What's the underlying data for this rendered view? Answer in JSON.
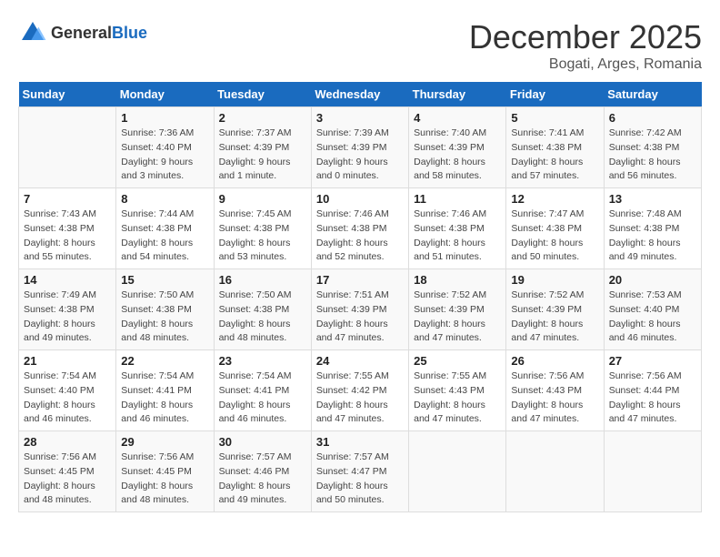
{
  "header": {
    "logo_general": "General",
    "logo_blue": "Blue",
    "title": "December 2025",
    "subtitle": "Bogati, Arges, Romania"
  },
  "calendar": {
    "days_of_week": [
      "Sunday",
      "Monday",
      "Tuesday",
      "Wednesday",
      "Thursday",
      "Friday",
      "Saturday"
    ],
    "weeks": [
      [
        {
          "day": "",
          "info": ""
        },
        {
          "day": "1",
          "info": "Sunrise: 7:36 AM\nSunset: 4:40 PM\nDaylight: 9 hours\nand 3 minutes."
        },
        {
          "day": "2",
          "info": "Sunrise: 7:37 AM\nSunset: 4:39 PM\nDaylight: 9 hours\nand 1 minute."
        },
        {
          "day": "3",
          "info": "Sunrise: 7:39 AM\nSunset: 4:39 PM\nDaylight: 9 hours\nand 0 minutes."
        },
        {
          "day": "4",
          "info": "Sunrise: 7:40 AM\nSunset: 4:39 PM\nDaylight: 8 hours\nand 58 minutes."
        },
        {
          "day": "5",
          "info": "Sunrise: 7:41 AM\nSunset: 4:38 PM\nDaylight: 8 hours\nand 57 minutes."
        },
        {
          "day": "6",
          "info": "Sunrise: 7:42 AM\nSunset: 4:38 PM\nDaylight: 8 hours\nand 56 minutes."
        }
      ],
      [
        {
          "day": "7",
          "info": "Sunrise: 7:43 AM\nSunset: 4:38 PM\nDaylight: 8 hours\nand 55 minutes."
        },
        {
          "day": "8",
          "info": "Sunrise: 7:44 AM\nSunset: 4:38 PM\nDaylight: 8 hours\nand 54 minutes."
        },
        {
          "day": "9",
          "info": "Sunrise: 7:45 AM\nSunset: 4:38 PM\nDaylight: 8 hours\nand 53 minutes."
        },
        {
          "day": "10",
          "info": "Sunrise: 7:46 AM\nSunset: 4:38 PM\nDaylight: 8 hours\nand 52 minutes."
        },
        {
          "day": "11",
          "info": "Sunrise: 7:46 AM\nSunset: 4:38 PM\nDaylight: 8 hours\nand 51 minutes."
        },
        {
          "day": "12",
          "info": "Sunrise: 7:47 AM\nSunset: 4:38 PM\nDaylight: 8 hours\nand 50 minutes."
        },
        {
          "day": "13",
          "info": "Sunrise: 7:48 AM\nSunset: 4:38 PM\nDaylight: 8 hours\nand 49 minutes."
        }
      ],
      [
        {
          "day": "14",
          "info": "Sunrise: 7:49 AM\nSunset: 4:38 PM\nDaylight: 8 hours\nand 49 minutes."
        },
        {
          "day": "15",
          "info": "Sunrise: 7:50 AM\nSunset: 4:38 PM\nDaylight: 8 hours\nand 48 minutes."
        },
        {
          "day": "16",
          "info": "Sunrise: 7:50 AM\nSunset: 4:38 PM\nDaylight: 8 hours\nand 48 minutes."
        },
        {
          "day": "17",
          "info": "Sunrise: 7:51 AM\nSunset: 4:39 PM\nDaylight: 8 hours\nand 47 minutes."
        },
        {
          "day": "18",
          "info": "Sunrise: 7:52 AM\nSunset: 4:39 PM\nDaylight: 8 hours\nand 47 minutes."
        },
        {
          "day": "19",
          "info": "Sunrise: 7:52 AM\nSunset: 4:39 PM\nDaylight: 8 hours\nand 47 minutes."
        },
        {
          "day": "20",
          "info": "Sunrise: 7:53 AM\nSunset: 4:40 PM\nDaylight: 8 hours\nand 46 minutes."
        }
      ],
      [
        {
          "day": "21",
          "info": "Sunrise: 7:54 AM\nSunset: 4:40 PM\nDaylight: 8 hours\nand 46 minutes."
        },
        {
          "day": "22",
          "info": "Sunrise: 7:54 AM\nSunset: 4:41 PM\nDaylight: 8 hours\nand 46 minutes."
        },
        {
          "day": "23",
          "info": "Sunrise: 7:54 AM\nSunset: 4:41 PM\nDaylight: 8 hours\nand 46 minutes."
        },
        {
          "day": "24",
          "info": "Sunrise: 7:55 AM\nSunset: 4:42 PM\nDaylight: 8 hours\nand 47 minutes."
        },
        {
          "day": "25",
          "info": "Sunrise: 7:55 AM\nSunset: 4:43 PM\nDaylight: 8 hours\nand 47 minutes."
        },
        {
          "day": "26",
          "info": "Sunrise: 7:56 AM\nSunset: 4:43 PM\nDaylight: 8 hours\nand 47 minutes."
        },
        {
          "day": "27",
          "info": "Sunrise: 7:56 AM\nSunset: 4:44 PM\nDaylight: 8 hours\nand 47 minutes."
        }
      ],
      [
        {
          "day": "28",
          "info": "Sunrise: 7:56 AM\nSunset: 4:45 PM\nDaylight: 8 hours\nand 48 minutes."
        },
        {
          "day": "29",
          "info": "Sunrise: 7:56 AM\nSunset: 4:45 PM\nDaylight: 8 hours\nand 48 minutes."
        },
        {
          "day": "30",
          "info": "Sunrise: 7:57 AM\nSunset: 4:46 PM\nDaylight: 8 hours\nand 49 minutes."
        },
        {
          "day": "31",
          "info": "Sunrise: 7:57 AM\nSunset: 4:47 PM\nDaylight: 8 hours\nand 50 minutes."
        },
        {
          "day": "",
          "info": ""
        },
        {
          "day": "",
          "info": ""
        },
        {
          "day": "",
          "info": ""
        }
      ]
    ]
  }
}
